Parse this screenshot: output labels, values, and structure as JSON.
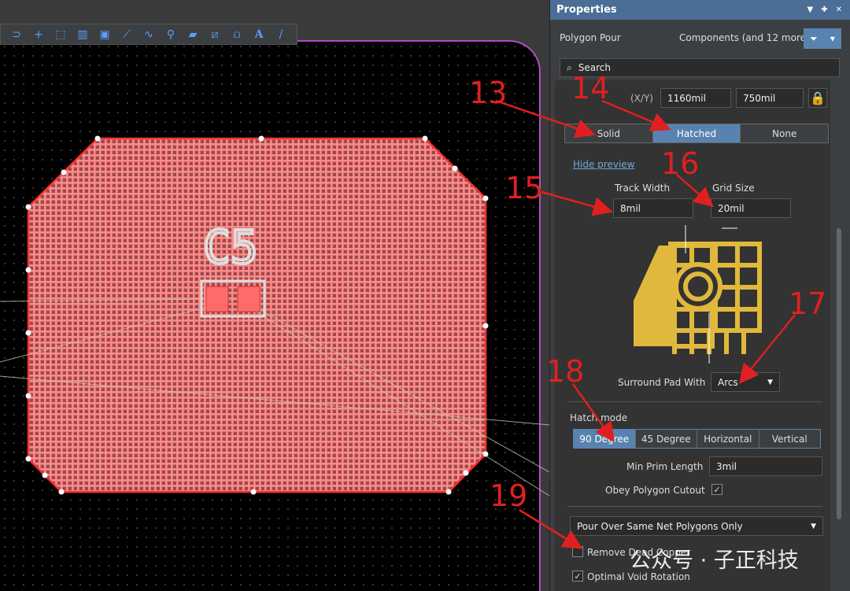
{
  "panel": {
    "title": "Properties",
    "object_type": "Polygon Pour",
    "filter_label": "Components (and 12 more)",
    "search_placeholder": "Search",
    "xy_label": "(X/Y)",
    "x_value": "1160mil",
    "y_value": "750mil",
    "fill_modes": [
      "Solid",
      "Hatched",
      "None"
    ],
    "fill_mode_selected": "Hatched",
    "hide_preview": "Hide preview",
    "track_width_label": "Track Width",
    "track_width_value": "8mil",
    "grid_size_label": "Grid Size",
    "grid_size_value": "20mil",
    "surround_pad_label": "Surround Pad With",
    "surround_pad_value": "Arcs",
    "hatch_mode_label": "Hatch mode",
    "hatch_modes": [
      "90 Degree",
      "45 Degree",
      "Horizontal",
      "Vertical"
    ],
    "hatch_mode_selected": "90 Degree",
    "min_prim_label": "Min Prim Length",
    "min_prim_value": "3mil",
    "obey_cutout_label": "Obey Polygon Cutout",
    "pour_over_value": "Pour Over Same Net Polygons Only",
    "remove_dead_copper_label": "Remove Dead Copper",
    "optimal_void_label": "Optimal Void Rotation"
  },
  "pcb": {
    "designator": "C5"
  },
  "annotations": [
    "13",
    "14",
    "15",
    "16",
    "17",
    "18",
    "19"
  ],
  "watermark": "公众号 · 子正科技",
  "colors": {
    "accent": "#5883b0",
    "header": "#4b6e96",
    "polygon": "#ff6b6b",
    "annotation": "#e02020",
    "preview_icon": "#e0b83c"
  }
}
